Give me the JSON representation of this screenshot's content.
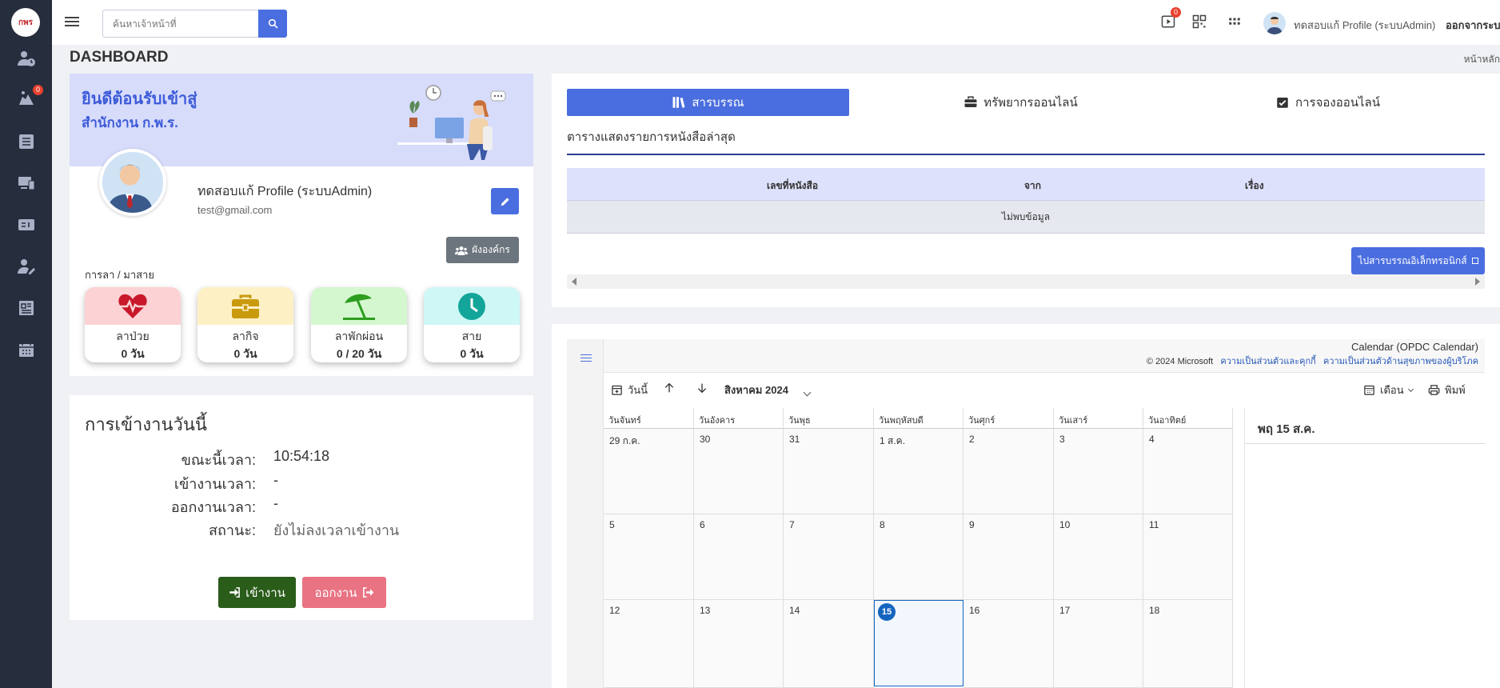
{
  "brand": {
    "logo_text": "กพร"
  },
  "sidebar": {
    "notification_badge": "0"
  },
  "topbar": {
    "search_placeholder": "ค้นหาเจ้าหน้าที่",
    "video_badge": "0",
    "user_name": "ทดสอบแก้ Profile (ระบบAdmin)",
    "logout_label": "ออกจากระบบ"
  },
  "page": {
    "title": "DASHBOARD",
    "breadcrumb": "หน้าหลัก"
  },
  "welcome": {
    "line1": "ยินดีต้อนรับเข้าสู่",
    "line2": "สำนักงาน ก.พ.ร."
  },
  "profile": {
    "name": "ทดสอบแก้ Profile (ระบบAdmin)",
    "email": "test@gmail.com",
    "org_button": "ผังองค์กร"
  },
  "leave": {
    "title": "การลา / มาสาย",
    "items": [
      {
        "label": "ลาป่วย",
        "value": "0 วัน",
        "color": "#fcd2d4",
        "icon_color": "#c8182a"
      },
      {
        "label": "ลากิจ",
        "value": "0 วัน",
        "color": "#fdf0c5",
        "icon_color": "#c99a0e"
      },
      {
        "label": "ลาพักผ่อน",
        "value": "0 / 20 วัน",
        "color": "#d5f7d0",
        "icon_color": "#2d9e20"
      },
      {
        "label": "สาย",
        "value": "0 วัน",
        "color": "#cff7f6",
        "icon_color": "#14a59a"
      }
    ]
  },
  "attendance": {
    "title": "การเข้างานวันนี้",
    "rows": [
      {
        "key": "ขณะนี้เวลา:",
        "value": "10:54:18"
      },
      {
        "key": "เข้างานเวลา:",
        "value": "-"
      },
      {
        "key": "ออกงานเวลา:",
        "value": "-"
      },
      {
        "key": "สถานะ:",
        "value": "ยังไม่ลงเวลาเข้างาน"
      }
    ],
    "checkin_label": "เข้างาน",
    "checkout_label": "ออกงาน"
  },
  "doc_panel": {
    "tabs": [
      {
        "label": "สารบรรณ",
        "active": true
      },
      {
        "label": "ทรัพยากรออนไลน์",
        "active": false
      },
      {
        "label": "การจองออนไลน์",
        "active": false
      }
    ],
    "subtitle": "ตารางแสดงรายการหนังสือล่าสุด",
    "columns": [
      "เลขที่หนังสือ",
      "จาก",
      "เรื่อง"
    ],
    "empty_text": "ไม่พบข้อมูล",
    "ebook_button": "ไปสารบรรณอิเล็กทรอนิกส์"
  },
  "calendar": {
    "name": "Calendar (OPDC Calendar)",
    "copyright": "© 2024 Microsoft",
    "link1": "ความเป็นส่วนตัวและคุกกี้",
    "link2": "ความเป็นส่วนตัวด้านสุขภาพของผู้บริโภค",
    "today_label": "วันนี้",
    "month_label": "สิงหาคม 2024",
    "view_label": "เดือน",
    "print_label": "พิมพ์",
    "weekdays": [
      "วันจันทร์",
      "วันอังคาร",
      "วันพุธ",
      "วันพฤหัสบดี",
      "วันศุกร์",
      "วันเสาร์",
      "วันอาทิตย์"
    ],
    "weeks": [
      [
        "29 ก.ค.",
        "30",
        "31",
        "1 ส.ค.",
        "2",
        "3",
        "4"
      ],
      [
        "5",
        "6",
        "7",
        "8",
        "9",
        "10",
        "11"
      ],
      [
        "12",
        "13",
        "14",
        "15",
        "16",
        "17",
        "18"
      ]
    ],
    "today_cell": "15",
    "agenda_date": "พฤ 15 ส.ค."
  }
}
